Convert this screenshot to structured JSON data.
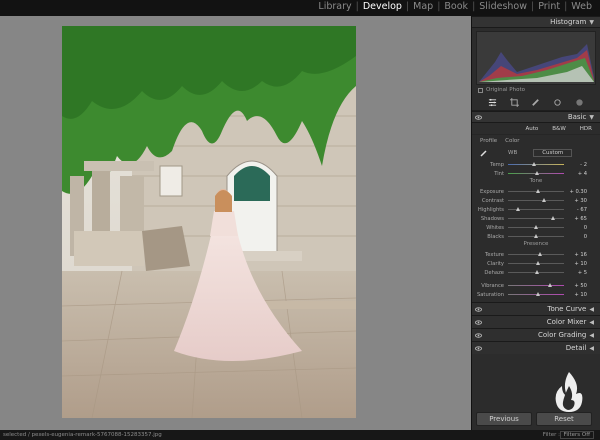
{
  "modules": [
    {
      "label": "Library",
      "active": false
    },
    {
      "label": "Develop",
      "active": true
    },
    {
      "label": "Map",
      "active": false
    },
    {
      "label": "Book",
      "active": false
    },
    {
      "label": "Slideshow",
      "active": false
    },
    {
      "label": "Print",
      "active": false
    },
    {
      "label": "Web",
      "active": false
    }
  ],
  "histogram": {
    "title": "Histogram",
    "original_photo_label": "Original Photo"
  },
  "basic": {
    "title": "Basic",
    "treatment": {
      "auto": "Auto",
      "bw": "B&W",
      "hdr": "HDR"
    },
    "profile_label": "Profile",
    "profile_value": "Color",
    "wb_label": "WB",
    "wb_value": "Custom",
    "temp": {
      "label": "Temp",
      "value": "- 2",
      "pos": 0.48
    },
    "tint": {
      "label": "Tint",
      "value": "+ 4",
      "pos": 0.52
    },
    "tone_heading": "Tone",
    "exposure": {
      "label": "Exposure",
      "value": "+ 0.30",
      "pos": 0.55
    },
    "contrast": {
      "label": "Contrast",
      "value": "+ 30",
      "pos": 0.65
    },
    "highlights": {
      "label": "Highlights",
      "value": "- 67",
      "pos": 0.18
    },
    "shadows": {
      "label": "Shadows",
      "value": "+ 65",
      "pos": 0.82
    },
    "whites": {
      "label": "Whites",
      "value": "0",
      "pos": 0.5
    },
    "blacks": {
      "label": "Blacks",
      "value": "0",
      "pos": 0.5
    },
    "presence_heading": "Presence",
    "texture": {
      "label": "Texture",
      "value": "+ 16",
      "pos": 0.58
    },
    "clarity": {
      "label": "Clarity",
      "value": "+ 10",
      "pos": 0.55
    },
    "dehaze": {
      "label": "Dehaze",
      "value": "+ 5",
      "pos": 0.52
    },
    "vibrance": {
      "label": "Vibrance",
      "value": "+ 50",
      "pos": 0.75
    },
    "saturation": {
      "label": "Saturation",
      "value": "+ 10",
      "pos": 0.55
    }
  },
  "sections": {
    "tone_curve": "Tone Curve",
    "color_mixer": "Color Mixer",
    "color_grading": "Color Grading",
    "detail": "Detail"
  },
  "buttons": {
    "previous": "Previous",
    "reset": "Reset"
  },
  "status": {
    "selected": "selected / pexels-eugenia-remark-5767088-15283357.jpg",
    "filter_label": "Filter :",
    "filter_value": "Filters Off"
  }
}
